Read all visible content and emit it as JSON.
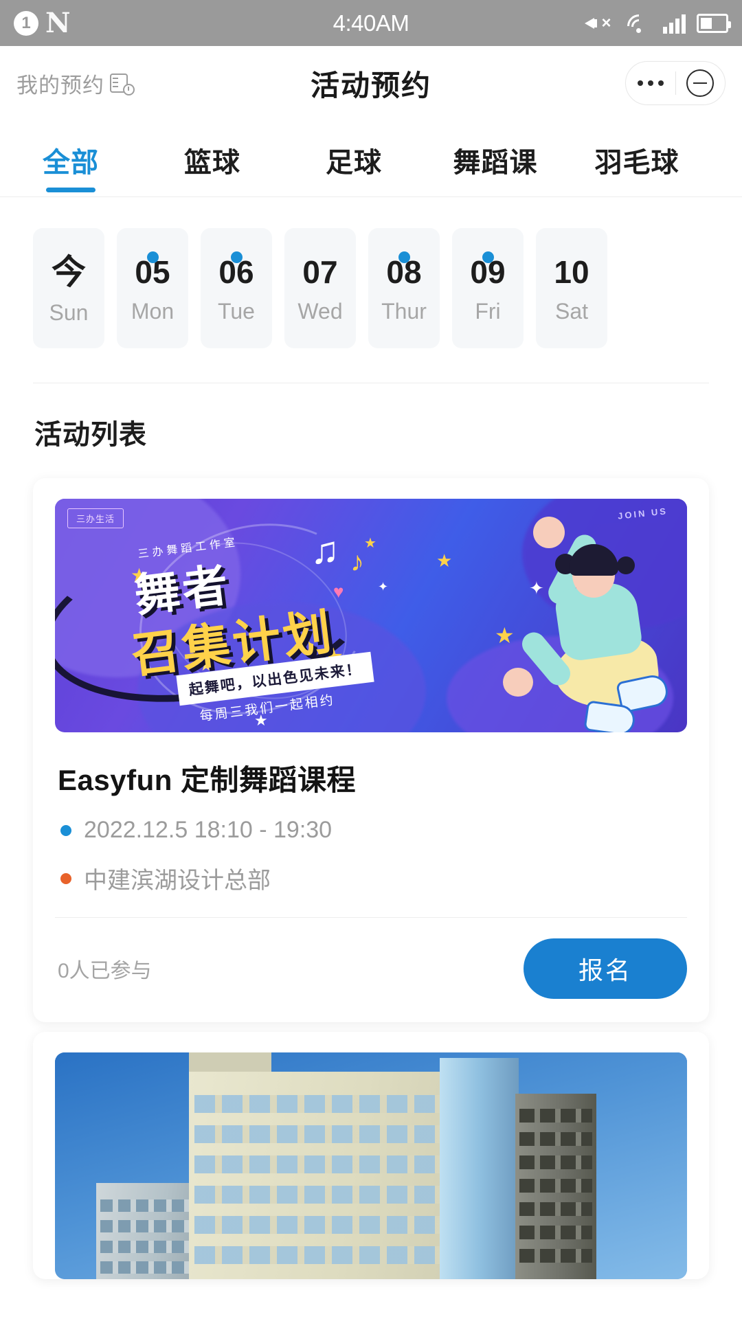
{
  "status_bar": {
    "notification_count": "1",
    "carrier_glyph": "N",
    "time": "4:40AM",
    "icons": [
      "mute-icon",
      "wifi-icon",
      "signal-icon",
      "battery-icon"
    ]
  },
  "header": {
    "back_label": "我的预约",
    "back_icon": "calendar-clock-icon",
    "title": "活动预约",
    "capsule": {
      "more_icon": "more-dots-icon",
      "minimize_icon": "minimize-circle-icon"
    }
  },
  "tabs": [
    {
      "label": "全部",
      "active": true
    },
    {
      "label": "篮球",
      "active": false
    },
    {
      "label": "足球",
      "active": false
    },
    {
      "label": "舞蹈课",
      "active": false
    },
    {
      "label": "羽毛球",
      "active": false
    }
  ],
  "date_strip": [
    {
      "num": "今",
      "weekday": "Sun",
      "has_dot": false,
      "is_today": true
    },
    {
      "num": "05",
      "weekday": "Mon",
      "has_dot": true,
      "is_today": false
    },
    {
      "num": "06",
      "weekday": "Tue",
      "has_dot": true,
      "is_today": false
    },
    {
      "num": "07",
      "weekday": "Wed",
      "has_dot": false,
      "is_today": false
    },
    {
      "num": "08",
      "weekday": "Thur",
      "has_dot": true,
      "is_today": false
    },
    {
      "num": "09",
      "weekday": "Fri",
      "has_dot": true,
      "is_today": false
    },
    {
      "num": "10",
      "weekday": "Sat",
      "has_dot": false,
      "is_today": false
    }
  ],
  "section": {
    "title": "活动列表"
  },
  "events": [
    {
      "banner": {
        "tag": "三办生活",
        "top_right": "JOIN US",
        "studio": "三办舞蹈工作室",
        "line1": "舞者",
        "line2": "召集计划",
        "sub": "起舞吧，以出色见未来！",
        "sub2": "每周三我们一起相约"
      },
      "title": "Easyfun 定制舞蹈课程",
      "time": "2022.12.5 18:10 - 19:30",
      "location": "中建滨湖设计总部",
      "joined": "0人已参与",
      "action_label": "报名"
    },
    {
      "banner": {
        "type": "building-photo"
      }
    }
  ],
  "colors": {
    "accent": "#1a8fd6",
    "button": "#1a80d0",
    "orange_dot": "#e8622a",
    "muted_text": "#9b9b9b",
    "status_bar_bg": "#9a9a9a"
  }
}
